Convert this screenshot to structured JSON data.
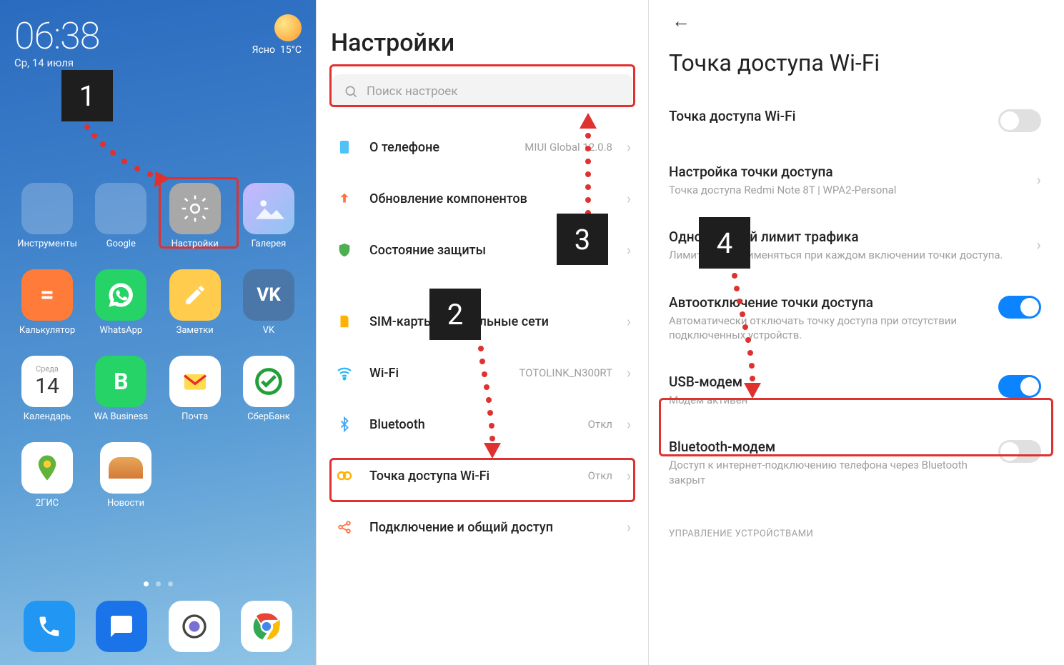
{
  "annotations": {
    "m1": "1",
    "m2": "2",
    "m3": "3",
    "m4": "4"
  },
  "panel1": {
    "time": "06:38",
    "date": "Ср, 14 июля",
    "weather_desc": "Ясно",
    "weather_temp": "15°C",
    "apps": {
      "tools": "Инструменты",
      "google": "Google",
      "settings": "Настройки",
      "gallery": "Галерея",
      "calc": "Калькулятор",
      "whatsapp": "WhatsApp",
      "notes": "Заметки",
      "vk": "VK",
      "calendar": "Календарь",
      "cal_dow": "Среда",
      "cal_day": "14",
      "wab": "WA Business",
      "mail": "Почта",
      "sber": "СберБанк",
      "gis": "2ГИС",
      "news": "Новости"
    }
  },
  "panel2": {
    "title": "Настройки",
    "search_placeholder": "Поиск настроек",
    "about": "О телефоне",
    "about_val": "MIUI Global 12.0.8",
    "update": "Обновление компонентов",
    "security": "Состояние защиты",
    "sim": "SIM-карты и мобильные сети",
    "wifi": "Wi-Fi",
    "wifi_val": "TOTOLINK_N300RT",
    "bt": "Bluetooth",
    "bt_val": "Откл",
    "hotspot": "Точка доступа Wi-Fi",
    "hotspot_val": "Откл",
    "connection": "Подключение и общий доступ"
  },
  "panel3": {
    "title": "Точка доступа Wi-Fi",
    "r1": "Точка доступа Wi-Fi",
    "r2t": "Настройка точки доступа",
    "r2s": "Точка доступа Redmi Note 8T | WPA2-Personal",
    "r3t": "Однократный лимит трафика",
    "r3s": "Лимит будет применяться при каждом включении точки доступа.",
    "r4t": "Автоотключение точки доступа",
    "r4s": "Автоматически отключать точку доступа при отсутствии подключенных устройств.",
    "r5t": "USB-модем",
    "r5s": "Модем активен",
    "r6t": "Bluetooth-модем",
    "r6s": "Доступ к интернет-подключению телефона через Bluetooth закрыт",
    "section": "УПРАВЛЕНИЕ УСТРОЙСТВАМИ"
  }
}
